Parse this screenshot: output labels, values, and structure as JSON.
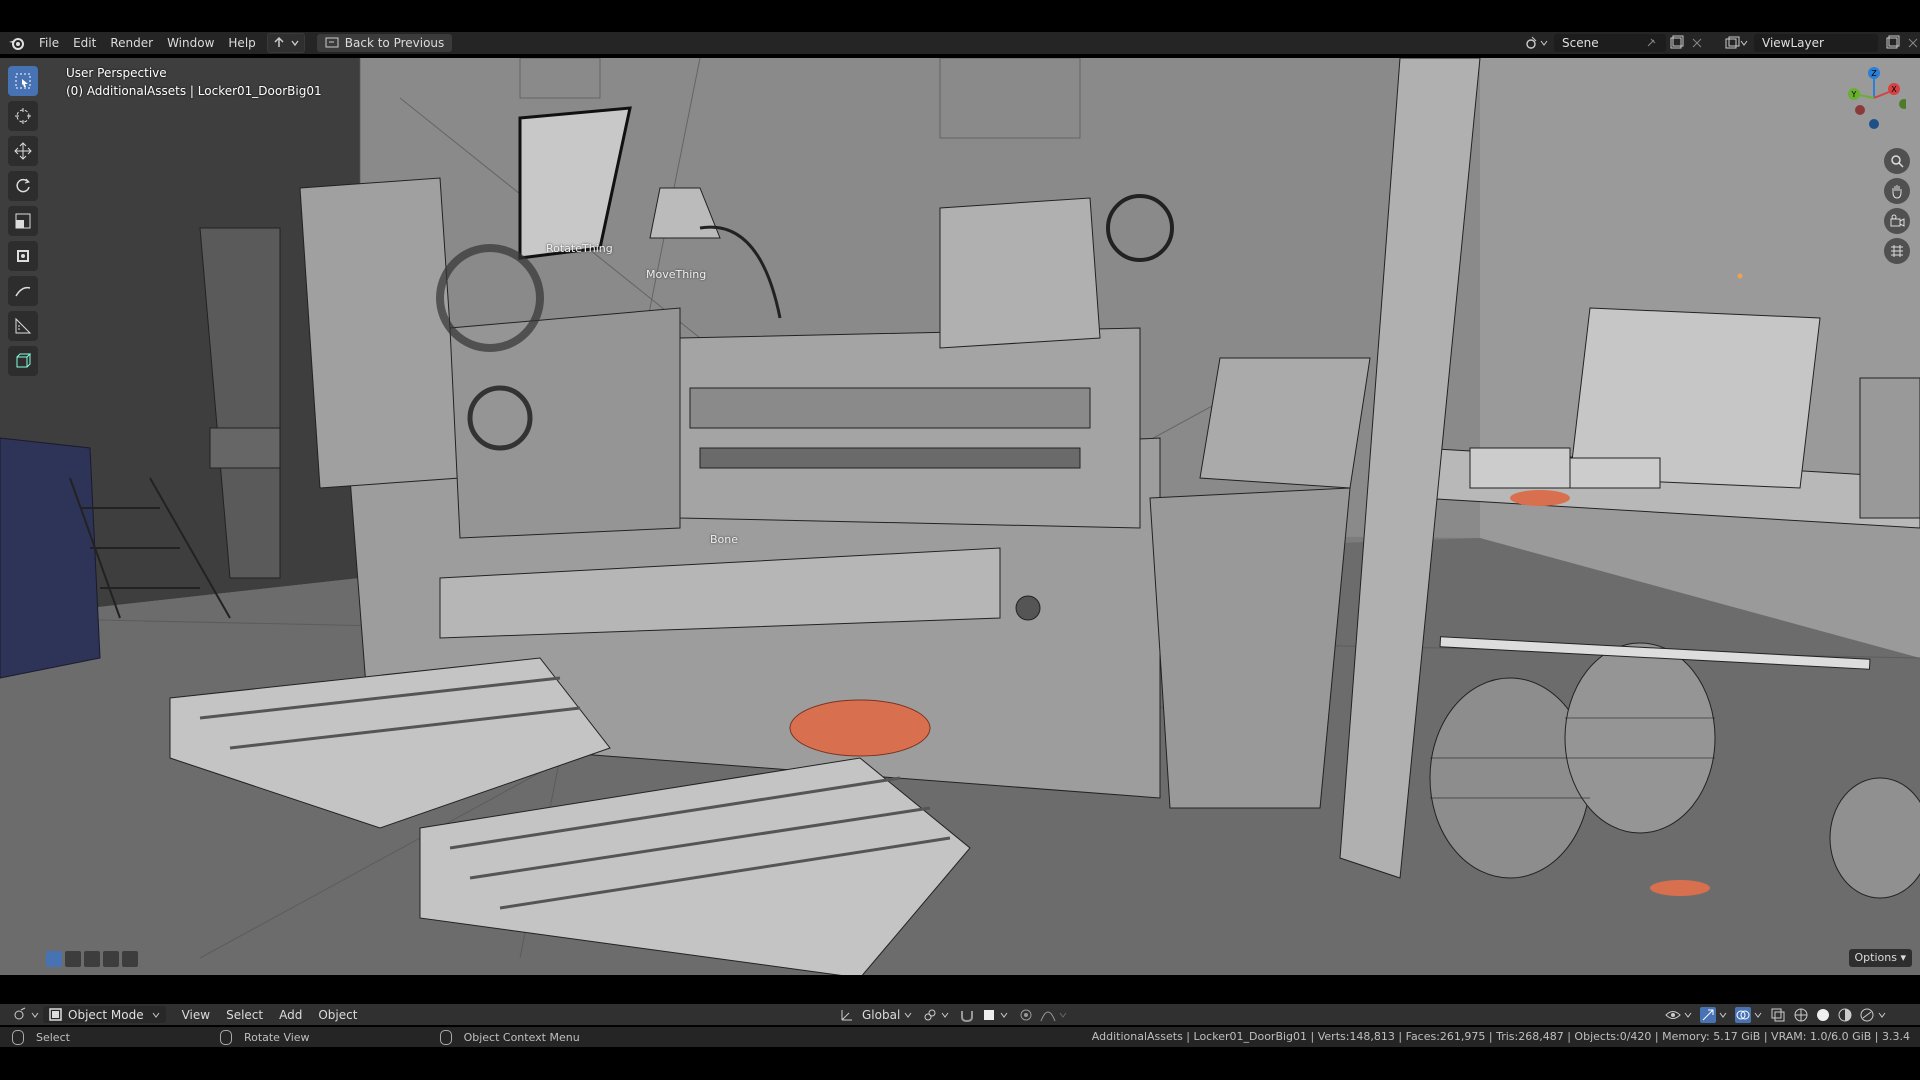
{
  "menu": {
    "items": [
      "File",
      "Edit",
      "Render",
      "Window",
      "Help"
    ],
    "back_button": "Back to Previous"
  },
  "topright": {
    "scene_label": "Scene",
    "viewlayer_label": "ViewLayer"
  },
  "viewport": {
    "perspective": "User Perspective",
    "active_object": "(0) AdditionalAssets | Locker01_DoorBig01",
    "labels": {
      "rotate": "RotateThing",
      "move": "MoveThing",
      "bone": "Bone"
    },
    "options_label": "Options"
  },
  "header": {
    "mode": "Object Mode",
    "menu": [
      "View",
      "Select",
      "Add",
      "Object"
    ],
    "orientation": "Global"
  },
  "status": {
    "left_hint": "Select",
    "middle_hint": "Rotate View",
    "right_hint": "Object Context Menu",
    "stats": "AdditionalAssets | Locker01_DoorBig01 | Verts:148,813 | Faces:261,975 | Tris:268,487 | Objects:0/420 | Memory: 5.17 GiB | VRAM: 1.0/6.0 GiB | 3.3.4"
  },
  "colors": {
    "accent": "#4772b3",
    "viewport_bg": "#7a7a7a",
    "object_highlight": "#d8704f"
  },
  "icons": [
    "blender-logo-icon",
    "select-box-icon",
    "cursor-icon",
    "move-icon",
    "rotate-icon",
    "scale-icon",
    "transform-icon",
    "annotate-icon",
    "measure-icon",
    "add-cube-icon",
    "zoom-icon",
    "pan-icon",
    "camera-icon",
    "grid-icon"
  ]
}
